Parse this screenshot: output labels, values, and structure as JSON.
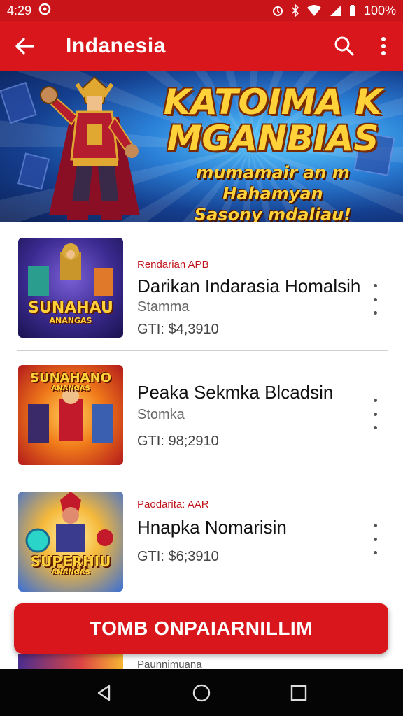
{
  "status_bar": {
    "time": "4:29",
    "battery": "100%"
  },
  "app_bar": {
    "title": "Indanesia"
  },
  "banner": {
    "headline_line1": "KATOIMA K",
    "headline_line2": "MGANBIAS",
    "subline_line1": "mumamair an m Hahamyan",
    "subline_line2": "Sasony mdaliau!"
  },
  "items": [
    {
      "tag": "Rendarian APB",
      "name": "Darikan Indarasia Homalsih",
      "subtitle": "Stamma",
      "price": "GTI: $4,3910",
      "thumb_logo": "SUNAHAU",
      "thumb_logo_sub": "ANANGAS"
    },
    {
      "tag": "",
      "name": "Peaka Sekmka Blcadsin",
      "subtitle": "Stomka",
      "price": "GTI: 98;2910",
      "thumb_logo": "SUNAHANO",
      "thumb_logo_sub": "ANANGAS"
    },
    {
      "tag": "Paodarita: AAR",
      "name": "Hnapka Nomarisin",
      "subtitle": "",
      "price": "GTI: $6;3910",
      "thumb_logo": "SUPERHIU",
      "thumb_logo_sub": "ANANGAS"
    }
  ],
  "peek_item": {
    "tag": "Paunnimuana"
  },
  "cta": {
    "label": "TOMB ONPAIARNILLIM"
  },
  "colors": {
    "brand_red": "#d8161c",
    "status_red": "#c9141a",
    "tag_red": "#c0141a",
    "nav_black": "#050505"
  },
  "icons": {
    "back": "arrow-left-icon",
    "search": "search-icon",
    "overflow": "more-vert-icon",
    "nav_back": "triangle-back-icon",
    "nav_home": "circle-home-icon",
    "nav_recents": "square-recents-icon"
  }
}
